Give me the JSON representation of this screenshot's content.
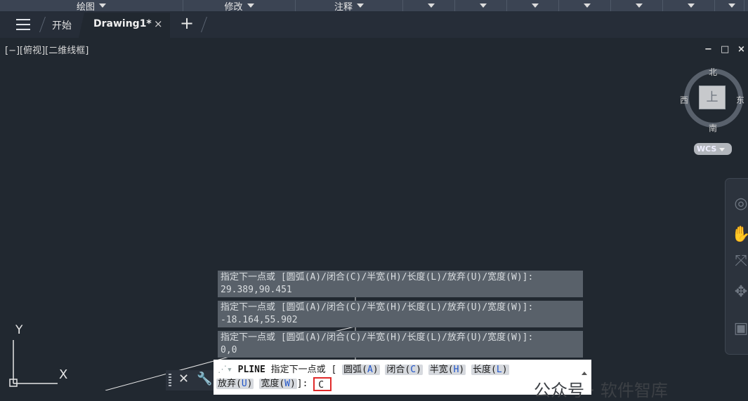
{
  "ribbon": {
    "panels": [
      {
        "label": "绘图",
        "width": 261
      },
      {
        "label": "修改",
        "width": 160
      },
      {
        "label": "注释",
        "width": 153
      },
      {
        "label": "",
        "width": 74
      },
      {
        "label": "",
        "width": 74
      },
      {
        "label": "",
        "width": 74
      },
      {
        "label": "",
        "width": 74
      },
      {
        "label": "",
        "width": 74
      },
      {
        "label": "",
        "width": 74
      },
      {
        "label": "",
        "width": 42
      }
    ]
  },
  "tabs": {
    "start": "开始",
    "active": "Drawing1*",
    "close": "×",
    "add": "+"
  },
  "viewport": {
    "label": "[−][俯视][二维线框]",
    "controls": [
      "−",
      "□",
      "×"
    ]
  },
  "viewcube": {
    "north": "北",
    "south": "南",
    "east": "东",
    "west": "西",
    "face": "上",
    "wcs": "WCS"
  },
  "history": [
    {
      "prompt": "指定下一点或 [圆弧(A)/闭合(C)/半宽(H)/长度(L)/放弃(U)/宽度(W)]:",
      "value": "29.389,90.451"
    },
    {
      "prompt": "指定下一点或 [圆弧(A)/闭合(C)/半宽(H)/长度(L)/放弃(U)/宽度(W)]:",
      "value": "-18.164,55.902"
    },
    {
      "prompt": "指定下一点或 [圆弧(A)/闭合(C)/半宽(H)/长度(L)/放弃(U)/宽度(W)]:",
      "value": "0,0"
    }
  ],
  "command": {
    "name": "PLINE",
    "prompt": "指定下一点或 [",
    "options_line1": [
      {
        "pre": "圆弧(",
        "key": "A",
        "post": ")"
      },
      {
        "pre": "闭合(",
        "key": "C",
        "post": ")"
      },
      {
        "pre": "半宽(",
        "key": "H",
        "post": ")"
      },
      {
        "pre": "长度(",
        "key": "L",
        "post": ")"
      }
    ],
    "options_line2": [
      {
        "pre": "放弃(",
        "key": "U",
        "post": ")"
      },
      {
        "pre": "宽度(",
        "key": "W",
        "post": ")"
      }
    ],
    "suffix": "]:",
    "input_value": "C"
  },
  "ucs": {
    "x": "X",
    "y": "Y"
  },
  "watermark": "公众号 · 软件智库",
  "colors": {
    "background": "#212830",
    "ribbon": "#3b4453",
    "history": "#59616a",
    "input_border": "#e02a2a",
    "option_key": "#2155c9"
  }
}
